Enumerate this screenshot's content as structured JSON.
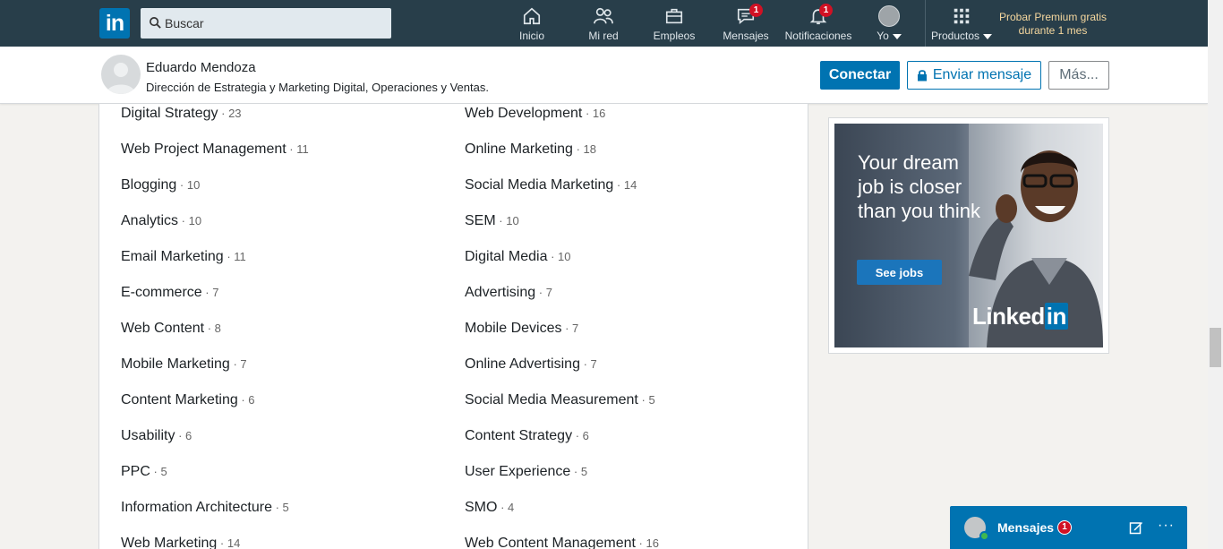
{
  "nav": {
    "logo_text": "in",
    "search_placeholder": "Buscar",
    "items": [
      {
        "label": "Inicio",
        "icon": "home-icon"
      },
      {
        "label": "Mi red",
        "icon": "network-icon"
      },
      {
        "label": "Empleos",
        "icon": "briefcase-icon"
      },
      {
        "label": "Mensajes",
        "icon": "messages-icon",
        "badge": "1"
      },
      {
        "label": "Notificaciones",
        "icon": "bell-icon",
        "badge": "1"
      },
      {
        "label": "Yo",
        "icon": "avatar"
      },
      {
        "label": "Productos",
        "icon": "grid-icon"
      }
    ],
    "premium": "Probar Premium gratis durante 1 mes"
  },
  "profile": {
    "name": "Eduardo Mendoza",
    "headline": "Dirección de Estrategia y Marketing Digital, Operaciones y Ventas.",
    "connect_label": "Conectar",
    "message_label": "Enviar mensaje",
    "more_label": "Más..."
  },
  "skills": {
    "left": [
      {
        "name": "Digital Strategy",
        "count": "23"
      },
      {
        "name": "Web Project Management",
        "count": "11"
      },
      {
        "name": "Blogging",
        "count": "10"
      },
      {
        "name": "Analytics",
        "count": "10"
      },
      {
        "name": "Email Marketing",
        "count": "11"
      },
      {
        "name": "E-commerce",
        "count": "7"
      },
      {
        "name": "Web Content",
        "count": "8"
      },
      {
        "name": "Mobile Marketing",
        "count": "7"
      },
      {
        "name": "Content Marketing",
        "count": "6"
      },
      {
        "name": "Usability",
        "count": "6"
      },
      {
        "name": "PPC",
        "count": "5"
      },
      {
        "name": "Information Architecture",
        "count": "5"
      },
      {
        "name": "Web Marketing",
        "count": "14"
      }
    ],
    "right": [
      {
        "name": "Web Development",
        "count": "16"
      },
      {
        "name": "Online Marketing",
        "count": "18"
      },
      {
        "name": "Social Media Marketing",
        "count": "14"
      },
      {
        "name": "SEM",
        "count": "10"
      },
      {
        "name": "Digital Media",
        "count": "10"
      },
      {
        "name": "Advertising",
        "count": "7"
      },
      {
        "name": "Mobile Devices",
        "count": "7"
      },
      {
        "name": "Online Advertising",
        "count": "7"
      },
      {
        "name": "Social Media Measurement",
        "count": "5"
      },
      {
        "name": "Content Strategy",
        "count": "6"
      },
      {
        "name": "User Experience",
        "count": "5"
      },
      {
        "name": "SMO",
        "count": "4"
      },
      {
        "name": "Web Content Management",
        "count": "16"
      }
    ]
  },
  "ad": {
    "headline": "Your dream job is closer than you think",
    "button": "See jobs",
    "logo_text": "Linked",
    "logo_in": "in"
  },
  "messaging": {
    "label": "Mensajes",
    "badge": "1"
  },
  "colors": {
    "nav_bg": "#283e4a",
    "brand_blue": "#0073b1",
    "badge_red": "#d11124",
    "premium_gold": "#f5d79e"
  }
}
